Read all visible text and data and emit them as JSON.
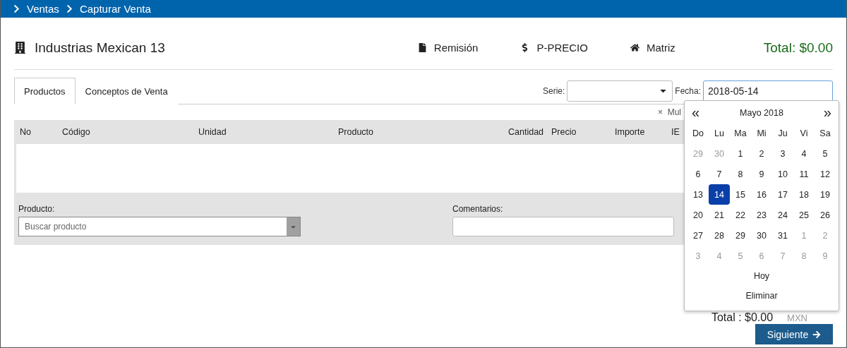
{
  "breadcrumb": [
    "Ventas",
    "Capturar Venta"
  ],
  "header": {
    "client": "Industrias Mexican 13",
    "actions": [
      {
        "kind": "file",
        "label": "Remisión"
      },
      {
        "kind": "dollar",
        "label": "P-PRECIO"
      },
      {
        "kind": "home",
        "label": "Matriz"
      }
    ],
    "total": "Total: $0.00"
  },
  "tabs": [
    {
      "label": "Productos",
      "selected": true
    },
    {
      "label": "Conceptos de Venta",
      "selected": false
    }
  ],
  "serie": {
    "label": "Serie:"
  },
  "fecha": {
    "label": "Fecha:",
    "value": "2018-05-14"
  },
  "multi": {
    "icon": "×",
    "label": "Mul"
  },
  "table": {
    "columns": [
      "No",
      "Código",
      "Unidad",
      "Producto",
      "Cantidad",
      "Precio",
      "Importe",
      "IE"
    ]
  },
  "form": {
    "product_label": "Producto:",
    "product_placeholder": "Buscar producto",
    "comments_label": "Comentarios:"
  },
  "footer": {
    "total": "Total : $0.00",
    "currency": "MXN",
    "next": "Siguiente"
  },
  "calendar": {
    "prev": "«",
    "title": "Mayo 2018",
    "next": "»",
    "weekdays": [
      "Do",
      "Lu",
      "Ma",
      "Mi",
      "Ju",
      "Vi",
      "Sa"
    ],
    "weeks": [
      [
        {
          "label": "29",
          "muted": true,
          "selected": false
        },
        {
          "label": "30",
          "muted": true,
          "selected": false
        },
        {
          "label": "1",
          "muted": false,
          "selected": false
        },
        {
          "label": "2",
          "muted": false,
          "selected": false
        },
        {
          "label": "3",
          "muted": false,
          "selected": false
        },
        {
          "label": "4",
          "muted": false,
          "selected": false
        },
        {
          "label": "5",
          "muted": false,
          "selected": false
        }
      ],
      [
        {
          "label": "6",
          "muted": false,
          "selected": false
        },
        {
          "label": "7",
          "muted": false,
          "selected": false
        },
        {
          "label": "8",
          "muted": false,
          "selected": false
        },
        {
          "label": "9",
          "muted": false,
          "selected": false
        },
        {
          "label": "10",
          "muted": false,
          "selected": false
        },
        {
          "label": "11",
          "muted": false,
          "selected": false
        },
        {
          "label": "12",
          "muted": false,
          "selected": false
        }
      ],
      [
        {
          "label": "13",
          "muted": false,
          "selected": false
        },
        {
          "label": "14",
          "muted": false,
          "selected": true
        },
        {
          "label": "15",
          "muted": false,
          "selected": false
        },
        {
          "label": "16",
          "muted": false,
          "selected": false
        },
        {
          "label": "17",
          "muted": false,
          "selected": false
        },
        {
          "label": "18",
          "muted": false,
          "selected": false
        },
        {
          "label": "19",
          "muted": false,
          "selected": false
        }
      ],
      [
        {
          "label": "20",
          "muted": false,
          "selected": false
        },
        {
          "label": "21",
          "muted": false,
          "selected": false
        },
        {
          "label": "22",
          "muted": false,
          "selected": false
        },
        {
          "label": "23",
          "muted": false,
          "selected": false
        },
        {
          "label": "24",
          "muted": false,
          "selected": false
        },
        {
          "label": "25",
          "muted": false,
          "selected": false
        },
        {
          "label": "26",
          "muted": false,
          "selected": false
        }
      ],
      [
        {
          "label": "27",
          "muted": false,
          "selected": false
        },
        {
          "label": "28",
          "muted": false,
          "selected": false
        },
        {
          "label": "29",
          "muted": false,
          "selected": false
        },
        {
          "label": "30",
          "muted": false,
          "selected": false
        },
        {
          "label": "31",
          "muted": false,
          "selected": false
        },
        {
          "label": "1",
          "muted": true,
          "selected": false
        },
        {
          "label": "2",
          "muted": true,
          "selected": false
        }
      ],
      [
        {
          "label": "3",
          "muted": true,
          "selected": false
        },
        {
          "label": "4",
          "muted": true,
          "selected": false
        },
        {
          "label": "5",
          "muted": true,
          "selected": false
        },
        {
          "label": "6",
          "muted": true,
          "selected": false
        },
        {
          "label": "7",
          "muted": true,
          "selected": false
        },
        {
          "label": "8",
          "muted": true,
          "selected": false
        },
        {
          "label": "9",
          "muted": true,
          "selected": false
        }
      ]
    ],
    "today": "Hoy",
    "clear": "Eliminar"
  }
}
